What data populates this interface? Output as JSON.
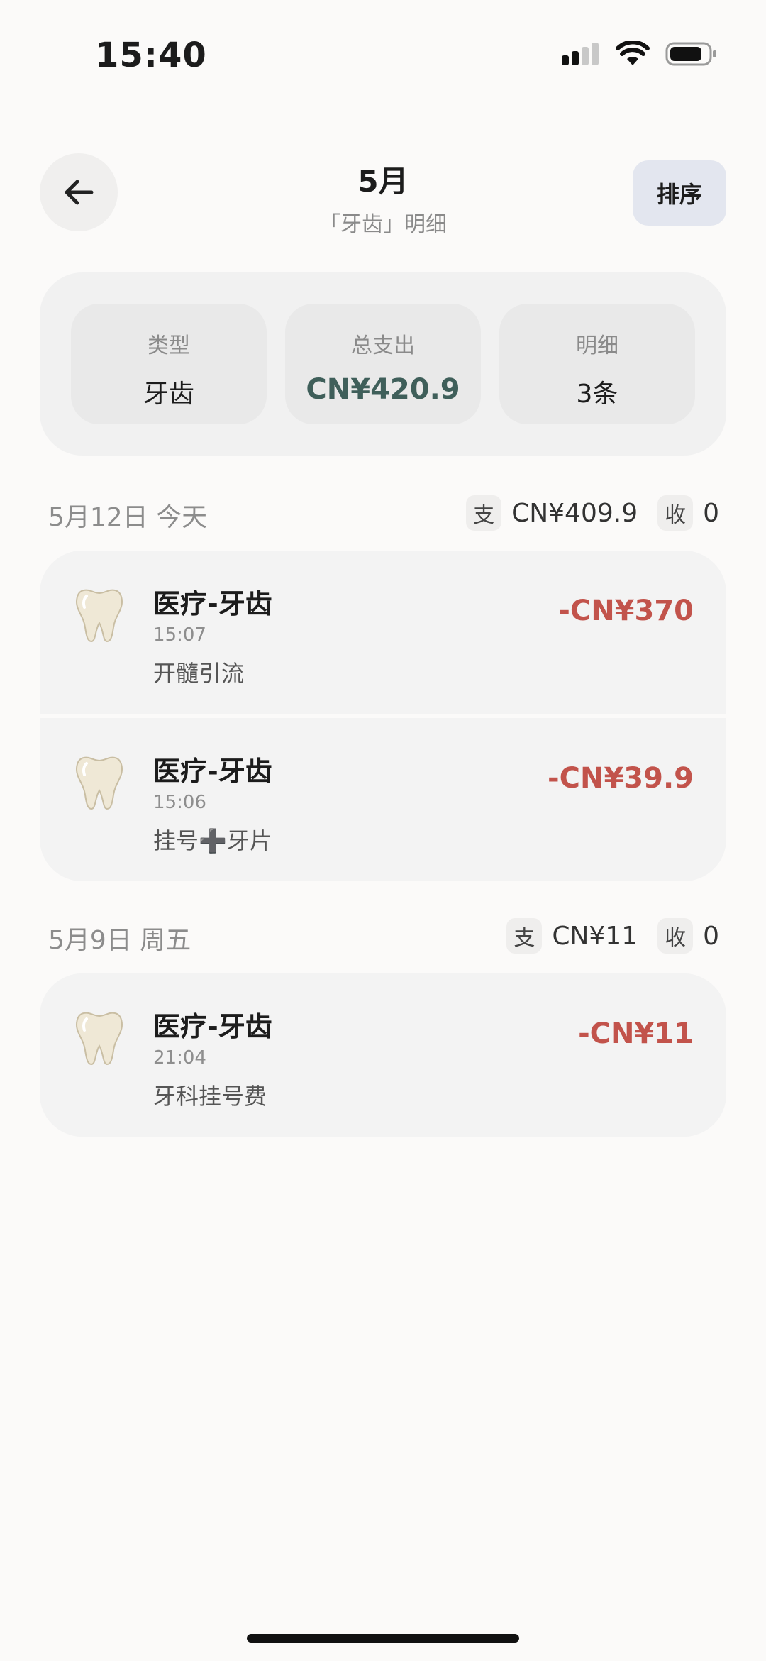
{
  "status": {
    "time": "15:40"
  },
  "header": {
    "title": "5月",
    "subtitle": "「牙齿」明细",
    "sort_label": "排序"
  },
  "summary": {
    "type_label": "类型",
    "type_value": "牙齿",
    "total_label": "总支出",
    "total_value": "CN¥420.9",
    "count_label": "明细",
    "count_value": "3条"
  },
  "groups": [
    {
      "date": "5月12日 今天",
      "expense_chip": "支",
      "expense_total": "CN¥409.9",
      "income_chip": "收",
      "income_total": "0",
      "entries": [
        {
          "category": "医疗-牙齿",
          "time": "15:07",
          "note": "开髓引流",
          "amount": "-CN¥370",
          "icon": "tooth-icon"
        },
        {
          "category": "医疗-牙齿",
          "time": "15:06",
          "note": "挂号➕牙片",
          "amount": "-CN¥39.9",
          "icon": "tooth-icon"
        }
      ]
    },
    {
      "date": "5月9日 周五",
      "expense_chip": "支",
      "expense_total": "CN¥11",
      "income_chip": "收",
      "income_total": "0",
      "entries": [
        {
          "category": "医疗-牙齿",
          "time": "21:04",
          "note": "牙科挂号费",
          "amount": "-CN¥11",
          "icon": "tooth-icon"
        }
      ]
    }
  ],
  "colors": {
    "background": "#fbfaf9",
    "card": "#f3f3f3",
    "expense_red": "#c2534b",
    "total_accent": "#3f5f5a",
    "sort_button": "#e3e6ef"
  }
}
